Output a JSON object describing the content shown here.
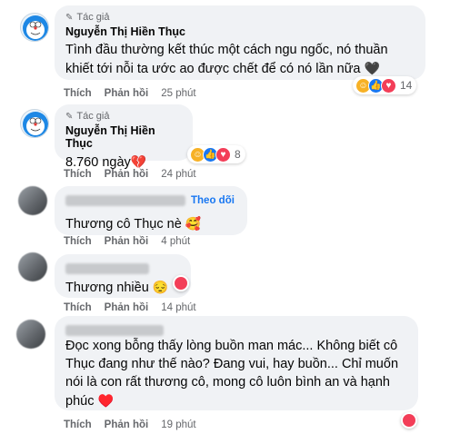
{
  "comments": [
    {
      "badge": "Tác giả",
      "author": "Nguyễn Thị Hiền Thục",
      "text_line1": "Tình đầu thường kết thúc một cách ngu ngốc, nó thuần",
      "text_line2": "khiết tới nỗi ta ước ao được chết để có nó lần nữa",
      "text_emoji": "🖤",
      "like": "Thích",
      "reply": "Phản hồi",
      "time": "25 phút",
      "reaction_count": "14"
    },
    {
      "badge": "Tác giả",
      "author": "Nguyễn Thị Hiền Thục",
      "text": "8.760 ngày",
      "text_emoji": "💔",
      "like": "Thích",
      "reply": "Phản hồi",
      "time": "24 phút",
      "reaction_count": "8"
    },
    {
      "follow": "Theo dõi",
      "text": "Thương cô Thục nè",
      "text_emoji": "🥰",
      "like": "Thích",
      "reply": "Phản hồi",
      "time": "4 phút"
    },
    {
      "text": "Thương nhiều",
      "text_emoji": "😔",
      "like": "Thích",
      "reply": "Phản hồi",
      "time": "14 phút"
    },
    {
      "text_line1": "Đọc xong bỗng thấy lòng buồn man mác... Không biết cô",
      "text_line2": "Thục đang như thế nào? Đang vui, hay buồn... Chỉ muốn",
      "text_line3": "nói là con rất thương cô, mong cô luôn bình an và hạnh",
      "text_line4": "phúc",
      "text_emoji": "♥️",
      "like": "Thích",
      "reply": "Phản hồi",
      "time": "19 phút"
    }
  ],
  "icons": {
    "badge": "pencil-icon",
    "care": "care-reaction-icon",
    "like": "like-reaction-icon",
    "love": "love-reaction-icon"
  },
  "colors": {
    "bubble": "#f0f2f5",
    "link": "#1877f2",
    "love": "#f33e58",
    "muted": "#65676b"
  }
}
